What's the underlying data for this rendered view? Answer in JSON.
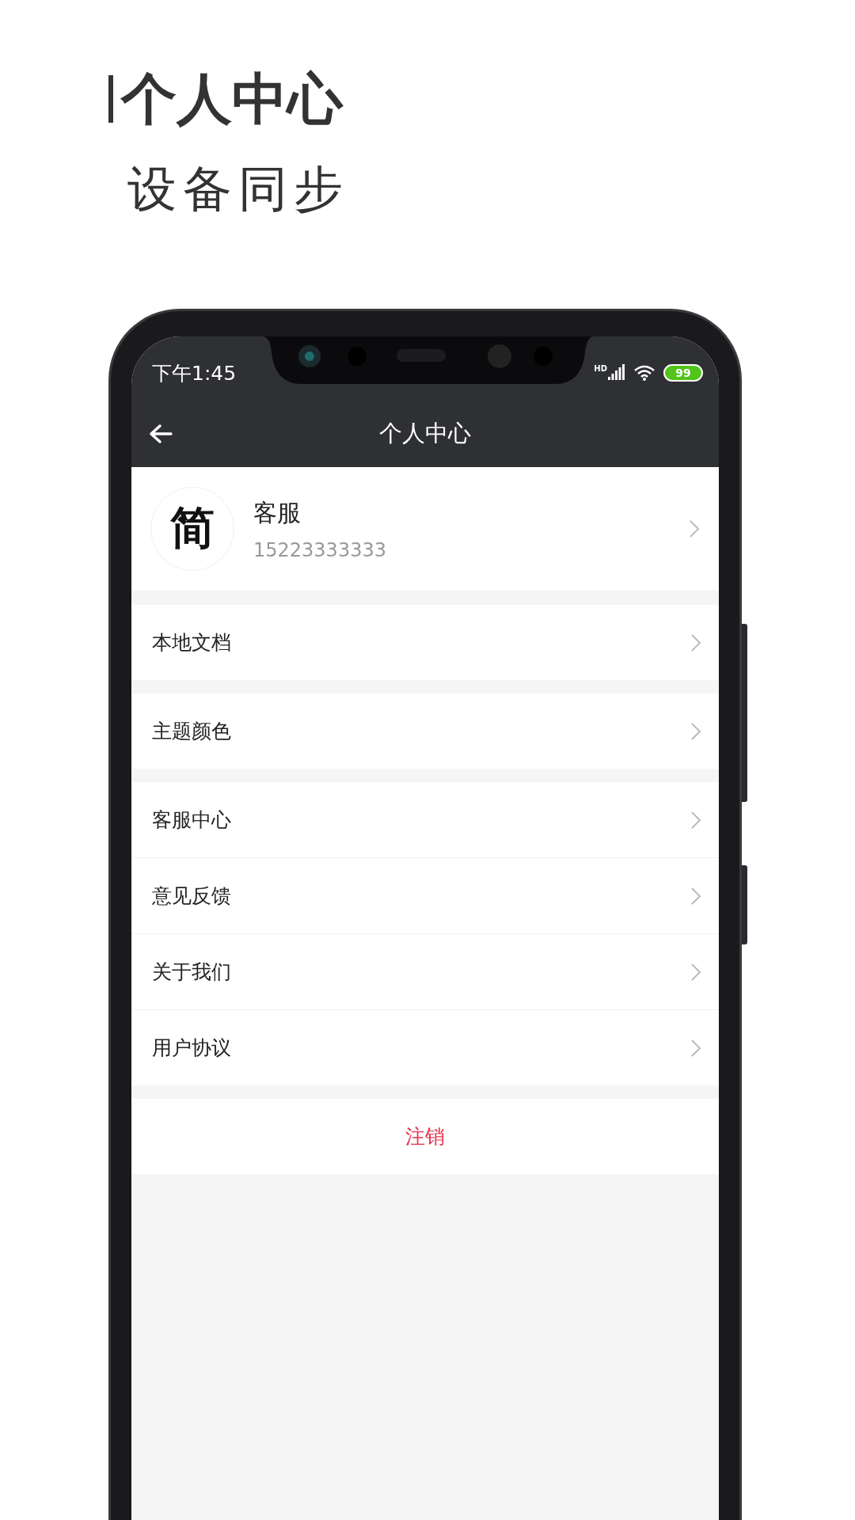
{
  "heading": "个人中心",
  "subheading": "设备同步",
  "status_bar": {
    "time": "下午1:45",
    "network_label": "HD",
    "battery": "99"
  },
  "nav": {
    "title": "个人中心"
  },
  "profile": {
    "avatar_text": "简",
    "name": "客服",
    "phone": "15223333333"
  },
  "menu_groups": [
    {
      "items": [
        {
          "label": "本地文档"
        }
      ]
    },
    {
      "items": [
        {
          "label": "主题颜色"
        }
      ]
    },
    {
      "items": [
        {
          "label": "客服中心"
        },
        {
          "label": "意见反馈"
        },
        {
          "label": "关于我们"
        },
        {
          "label": "用户协议"
        }
      ]
    }
  ],
  "logout": "注销"
}
